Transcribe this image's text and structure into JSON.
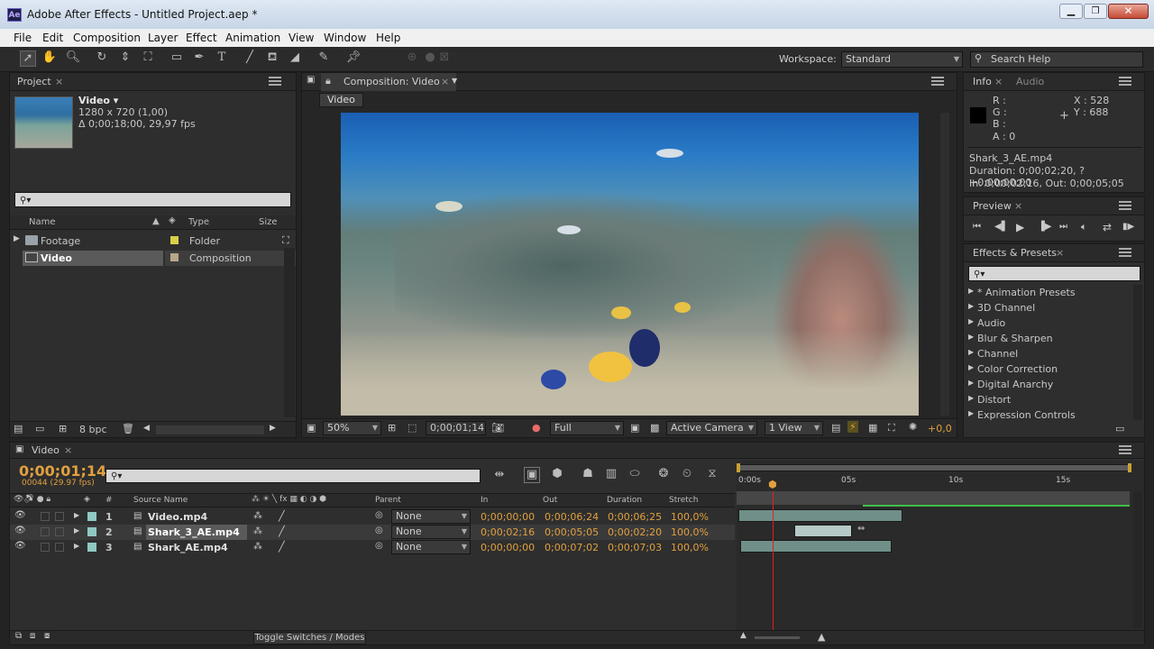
{
  "window": {
    "title": "Adobe After Effects - Untitled Project.aep *",
    "app_badge": "Ae"
  },
  "menu": [
    "File",
    "Edit",
    "Composition",
    "Layer",
    "Effect",
    "Animation",
    "View",
    "Window",
    "Help"
  ],
  "toolbar": {
    "workspace_label": "Workspace:",
    "workspace_value": "Standard",
    "search_placeholder": "Search Help"
  },
  "project": {
    "tab": "Project",
    "comp_name": "Video ▾",
    "comp_size": "1280 x 720 (1,00)",
    "comp_duration": "Δ 0;00;18;00, 29,97 fps",
    "columns": {
      "name": "Name",
      "type": "Type",
      "size": "Size"
    },
    "items": [
      {
        "name": "Footage",
        "type": "Folder",
        "color": "#d9d04a"
      },
      {
        "name": "Video",
        "type": "Composition",
        "color": "#b7a68a"
      }
    ],
    "bpc": "8 bpc"
  },
  "composition": {
    "tab": "Composition: Video",
    "flow_tab": "Video",
    "zoom": "50%",
    "timecode": "0;00;01;14",
    "resolution": "Full",
    "camera": "Active Camera",
    "views": "1 View",
    "exposure": "+0,0"
  },
  "info": {
    "tab": "Info",
    "tab2": "Audio",
    "r": "R :",
    "g": "G :",
    "b": "B :",
    "a": "A : 0",
    "x": "X : 528",
    "y": "Y : 688",
    "file": "Shark_3_AE.mp4",
    "duration": "Duration: 0;00;02;20, ? +0;00;00;00",
    "in_out": "In: 0;00;02;16, Out: 0;00;05;05"
  },
  "preview": {
    "tab": "Preview"
  },
  "effects": {
    "tab": "Effects & Presets",
    "items": [
      "* Animation Presets",
      "3D Channel",
      "Audio",
      "Blur & Sharpen",
      "Channel",
      "Color Correction",
      "Digital Anarchy",
      "Distort",
      "Expression Controls"
    ]
  },
  "timeline": {
    "tab": "Video",
    "current_time": "0;00;01;14",
    "frame_info": "00044 (29.97 fps)",
    "columns": {
      "num": "#",
      "source": "Source Name",
      "parent": "Parent",
      "in": "In",
      "out": "Out",
      "duration": "Duration",
      "stretch": "Stretch"
    },
    "ruler": [
      "0:00s",
      "05s",
      "10s",
      "15s"
    ],
    "layers": [
      {
        "num": "1",
        "name": "Video.mp4",
        "parent": "None",
        "in": "0;00;00;00",
        "out": "0;00;06;24",
        "duration": "0;00;06;25",
        "stretch": "100,0%",
        "color": "#8fc9c2"
      },
      {
        "num": "2",
        "name": "Shark_3_AE.mp4",
        "parent": "None",
        "in": "0;00;02;16",
        "out": "0;00;05;05",
        "duration": "0;00;02;20",
        "stretch": "100,0%",
        "color": "#8fc9c2"
      },
      {
        "num": "3",
        "name": "Shark_AE.mp4",
        "parent": "None",
        "in": "0;00;00;00",
        "out": "0;00;07;02",
        "duration": "0;00;07;03",
        "stretch": "100,0%",
        "color": "#8fc9c2"
      }
    ],
    "toggle_label": "Toggle Switches / Modes"
  }
}
